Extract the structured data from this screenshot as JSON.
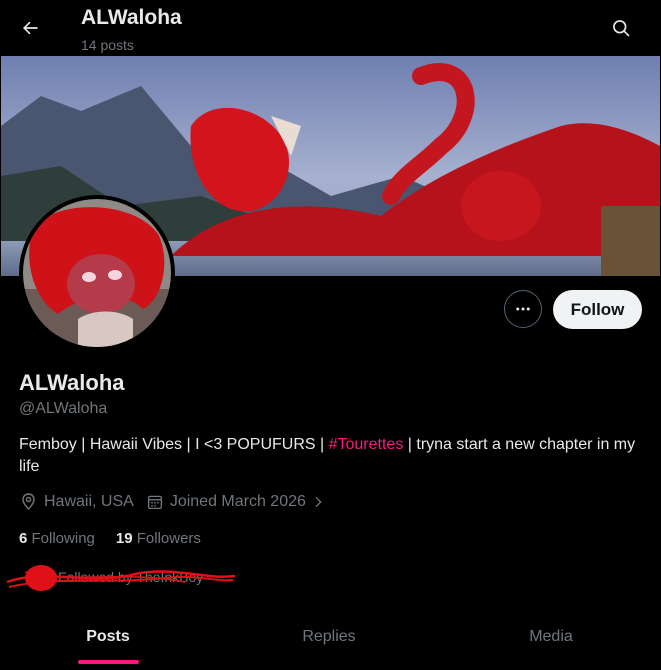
{
  "header": {
    "title": "ALWaloha",
    "posts_count": "14 posts"
  },
  "profile": {
    "display_name": "ALWaloha",
    "handle": "@ALWaloha",
    "bio_before": "Femboy | Hawaii Vibes |  I <3 POPUFURS | ",
    "bio_hashtag": "#Tourettes",
    "bio_after": " | tryna start a new chapter in my life",
    "location": "Hawaii, USA",
    "joined": "Joined March 2026",
    "following_count": "6",
    "following_label": "Following",
    "followers_count": "19",
    "followers_label": "Followers",
    "followed_by": "Followed by TheInkBoy"
  },
  "actions": {
    "follow_label": "Follow"
  },
  "tabs": [
    {
      "label": "Posts",
      "active": true
    },
    {
      "label": "Replies",
      "active": false
    },
    {
      "label": "Media",
      "active": false
    }
  ],
  "colors": {
    "accent": "#f91880",
    "background": "#000000",
    "text_primary": "#e7e9ea",
    "text_secondary": "#71767b"
  },
  "icons": [
    "back-arrow-icon",
    "search-icon",
    "more-icon",
    "location-icon",
    "calendar-icon",
    "chevron-right-icon"
  ]
}
